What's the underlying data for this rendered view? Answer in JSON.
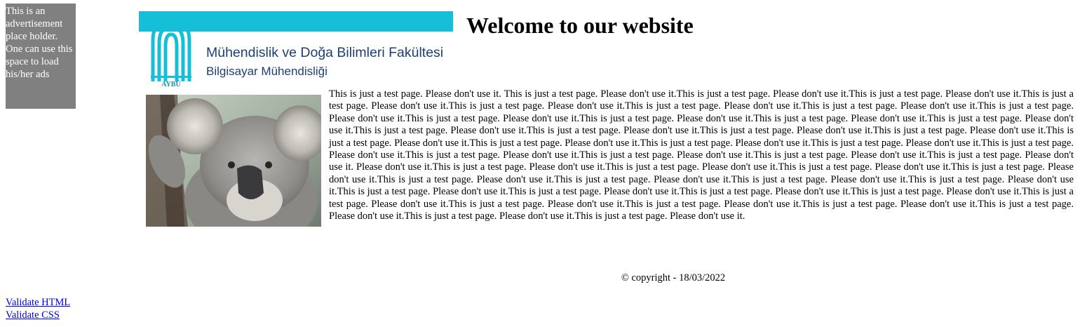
{
  "ad": {
    "text": "This is an advertisement place holder. One can use this space to load his/her ads"
  },
  "banner": {
    "faculty": "Mühendislik ve Doğa Bilimleri Fakültesi",
    "department": "Bilgisayar Mühendisliği",
    "logo_text": "AYBÜ",
    "accent_color": "#16bfd8",
    "text_color": "#1d3f73"
  },
  "heading": "Welcome to our website",
  "image": {
    "icon": "koala-photo"
  },
  "article": {
    "text": "This is just a test page. Please don't use it. This is just a test page. Please don't use it.This is just a test page. Please don't use it.This is just a test page. Please don't use it.This is just a test page. Please don't use it.This is just a test page. Please don't use it.This is just a test page. Please don't use it.This is just a test page. Please don't use it.This is just a test page. Please don't use it.This is just a test page. Please don't use it.This is just a test page. Please don't use it.This is just a test page. Please don't use it.This is just a test page. Please don't use it.This is just a test page. Please don't use it.This is just a test page. Please don't use it.This is just a test page. Please don't use it.This is just a test page. Please don't use it.This is just a test page. Please don't use it.This is just a test page. Please don't use it.This is just a test page. Please don't use it.This is just a test page. Please don't use it.This is just a test page. Please don't use it.This is just a test page. Please don't use it.This is just a test page. Please don't use it.This is just a test page. Please don't use it.This is just a test page. Please don't use it. Please don't use it.This is just a test page. Please don't use it.This is just a test page. Please don't use it.This is just a test page. Please don't use it.This is just a test page. Please don't use it.This is just a test page. Please don't use it.This is just a test page. Please don't use it.This is just a test page. Please don't use it.This is just a test page. Please don't use it.This is just a test page. Please don't use it.This is just a test page. Please don't use it.This is just a test page. Please don't use it.This is just a test page. Please don't use it.This is just a test page. Please don't use it.This is just a test page. Please don't use it.This is just a test page. Please don't use it.This is just a test page. Please don't use it.This is just a test page. Please don't use it.This is just a test page. Please don't use it.This is just a test page. Please don't use it."
  },
  "footer": {
    "copyright": "© copyright - 18/03/2022"
  },
  "links": {
    "validate_html": "Validate HTML",
    "validate_css": "Validate CSS"
  }
}
